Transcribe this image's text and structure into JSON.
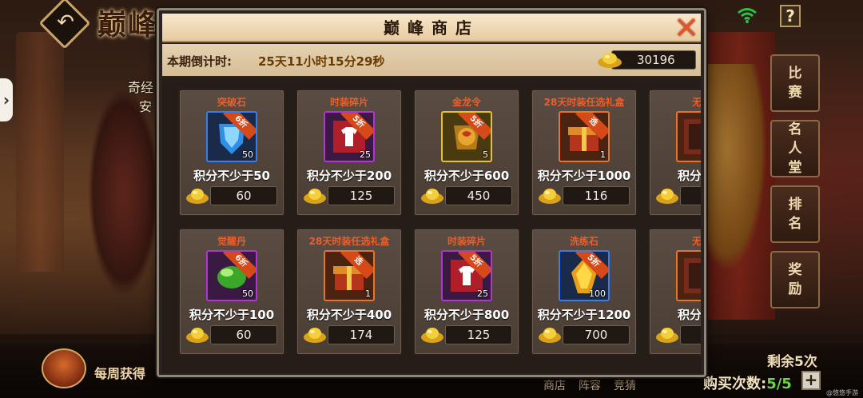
{
  "scene": {
    "title": "巅峰",
    "left_text_line1": "奇经",
    "left_text_line2": "安"
  },
  "side_buttons": [
    {
      "label": "比赛"
    },
    {
      "label": "名人堂"
    },
    {
      "label": "排名"
    },
    {
      "label": "奖励"
    }
  ],
  "modal": {
    "title": "巅峰商店",
    "countdown_label": "本期倒计时:",
    "countdown_value": "25天11小时15分29秒",
    "currency_value": "30196"
  },
  "items": [
    {
      "name": "突破石",
      "qty": "50",
      "discount": "6折",
      "requirement": "积分不少于50",
      "price": "60",
      "rarity": "blue",
      "icon": "breakthrough-stone-icon"
    },
    {
      "name": "时装碎片",
      "qty": "25",
      "discount": "5折",
      "requirement": "积分不少于200",
      "price": "125",
      "rarity": "purple",
      "icon": "costume-fragment-icon"
    },
    {
      "name": "金龙令",
      "qty": "5",
      "discount": "5折",
      "requirement": "积分不少于600",
      "price": "450",
      "rarity": "gold",
      "icon": "golden-dragon-token-icon"
    },
    {
      "name": "28天时装任选礼盒",
      "qty": "1",
      "discount": "选",
      "requirement": "积分不少于1000",
      "price": "116",
      "rarity": "orange",
      "icon": "gift-box-icon"
    },
    {
      "name": "无双",
      "qty": "",
      "discount": "",
      "requirement": "积分不少",
      "price": "",
      "rarity": "orange",
      "icon": "fragment-icon"
    },
    {
      "name": "觉醒丹",
      "qty": "50",
      "discount": "6折",
      "requirement": "积分不少于100",
      "price": "60",
      "rarity": "purple",
      "icon": "awakening-pill-icon"
    },
    {
      "name": "28天时装任选礼盒",
      "qty": "1",
      "discount": "选",
      "requirement": "积分不少于400",
      "price": "174",
      "rarity": "orange",
      "icon": "gift-box-icon"
    },
    {
      "name": "时装碎片",
      "qty": "25",
      "discount": "5折",
      "requirement": "积分不少于800",
      "price": "125",
      "rarity": "purple",
      "icon": "costume-fragment-icon"
    },
    {
      "name": "洗练石",
      "qty": "100",
      "discount": "5折",
      "requirement": "积分不少于1200",
      "price": "700",
      "rarity": "blue",
      "icon": "refining-stone-icon"
    },
    {
      "name": "无双",
      "qty": "",
      "discount": "",
      "requirement": "积分不少",
      "price": "",
      "rarity": "orange",
      "icon": "fragment-icon"
    }
  ],
  "bottom": {
    "weekly_text": "每周获得",
    "remaining": "剩余5次",
    "tabs": [
      "商店",
      "阵容",
      "竞猜"
    ],
    "buy_label": "购买次数:",
    "buy_count": "5/5",
    "watermark": "@悠悠手游网"
  },
  "colors": {
    "name_text": "#e8602e",
    "header_bg": "#f3e2c4",
    "accent_gold": "#e8c02a",
    "buy_count": "#6dd34a"
  }
}
